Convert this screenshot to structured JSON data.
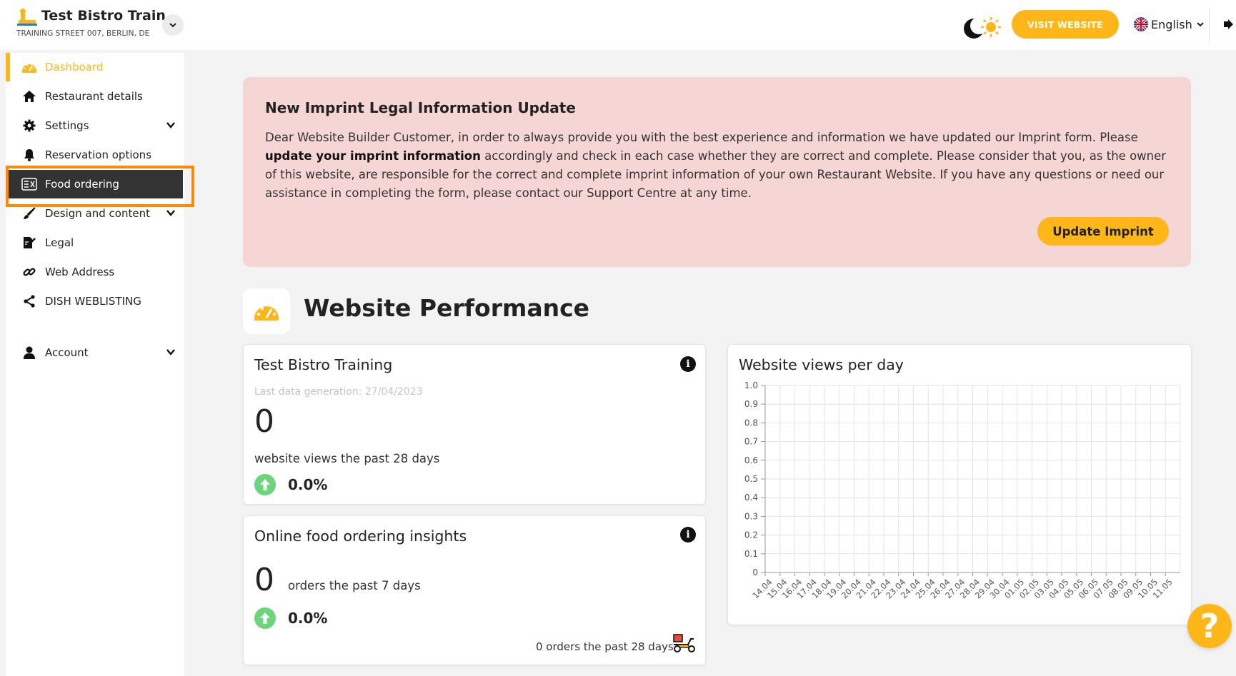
{
  "header": {
    "restaurant_name": "Test Bistro Train...",
    "address": "TRAINING STREET 007, BERLIN, DE",
    "visit_button": "VISIT WEBSITE",
    "language": "English",
    "brand_color": "#ffb618"
  },
  "sidebar": {
    "items": [
      {
        "label": "Dashboard",
        "icon": "gauge-icon",
        "state": "active"
      },
      {
        "label": "Restaurant details",
        "icon": "home-icon"
      },
      {
        "label": "Settings",
        "icon": "gear-icon",
        "expandable": true
      },
      {
        "label": "Reservation options",
        "icon": "bell-icon"
      },
      {
        "label": "Food ordering",
        "icon": "food-ordering-icon",
        "state": "selected"
      },
      {
        "label": "Design and content",
        "icon": "brush-icon",
        "expandable": true
      },
      {
        "label": "Legal",
        "icon": "signature-icon"
      },
      {
        "label": "Web Address",
        "icon": "link-icon"
      },
      {
        "label": "DISH WEBLISTING",
        "icon": "share-icon"
      },
      {
        "label": "Account",
        "icon": "user-icon",
        "expandable": true
      }
    ]
  },
  "alert": {
    "title": "New Imprint Legal Information Update",
    "body_part1": "Dear Website Builder Customer, in order to always provide you with the best experience and information we have updated our Imprint form. Please ",
    "body_bold": "update your imprint information",
    "body_part2": " accordingly and check in each case whether they are correct and complete. Please consider that you, as the owner of this website, are responsible for the correct and complete imprint information of your own Restaurant Website. If you have any questions or need our assistance in completing the form, please contact our Support Centre at any time.",
    "button": "Update Imprint",
    "background_color": "#f6d6d4"
  },
  "performance": {
    "title": "Website Performance",
    "views_card": {
      "title": "Test Bistro Training",
      "last_generation": "Last data generation: 27/04/2023",
      "views": "0",
      "views_label": "website views the past 28 days",
      "change": "0.0%"
    },
    "orders_card": {
      "title": "Online food ordering insights",
      "orders": "0",
      "orders_label": "orders the past 7 days",
      "change": "0.0%",
      "orders_28": "0 orders the past 28 days"
    },
    "chart_card": {
      "title": "Website views per day"
    }
  },
  "chart_data": {
    "type": "line",
    "title": "Website views per day",
    "x": [
      "14.04",
      "15.04",
      "16.04",
      "17.04",
      "18.04",
      "19.04",
      "20.04",
      "21.04",
      "22.04",
      "23.04",
      "24.04",
      "25.04",
      "26.04",
      "27.04",
      "28.04",
      "29.04",
      "30.04",
      "01.05",
      "02.05",
      "03.05",
      "04.05",
      "05.05",
      "06.05",
      "07.05",
      "08.05",
      "09.05",
      "10.05",
      "11.05"
    ],
    "series": [],
    "ylim": [
      0,
      1
    ],
    "yticks": [
      "0",
      "0.1",
      "0.2",
      "0.3",
      "0.4",
      "0.5",
      "0.6",
      "0.7",
      "0.8",
      "0.9",
      "1.0"
    ],
    "grid": true
  }
}
